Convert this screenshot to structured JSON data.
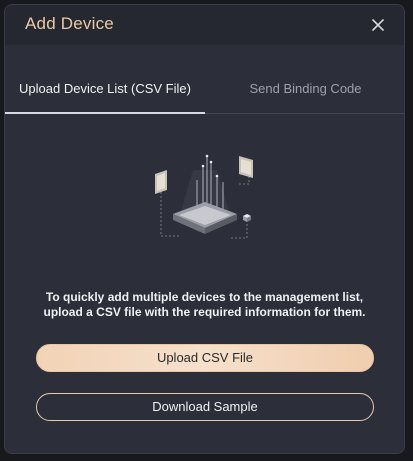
{
  "dialog": {
    "title": "Add Device",
    "close_icon": "close-icon"
  },
  "tabs": [
    {
      "label": "Upload Device List (CSV File)",
      "active": true
    },
    {
      "label": "Send Binding Code",
      "active": false
    }
  ],
  "illustration": {
    "icon": "device-upload-illustration"
  },
  "description": {
    "line1": "To quickly add multiple devices to the management list,",
    "line2": "upload a CSV file with the required information for them."
  },
  "buttons": {
    "upload_label": "Upload CSV File",
    "download_label": "Download Sample"
  },
  "colors": {
    "accent": "#e9c9a6",
    "background": "#2c2f39",
    "primary_button": "#f2d3b6"
  }
}
